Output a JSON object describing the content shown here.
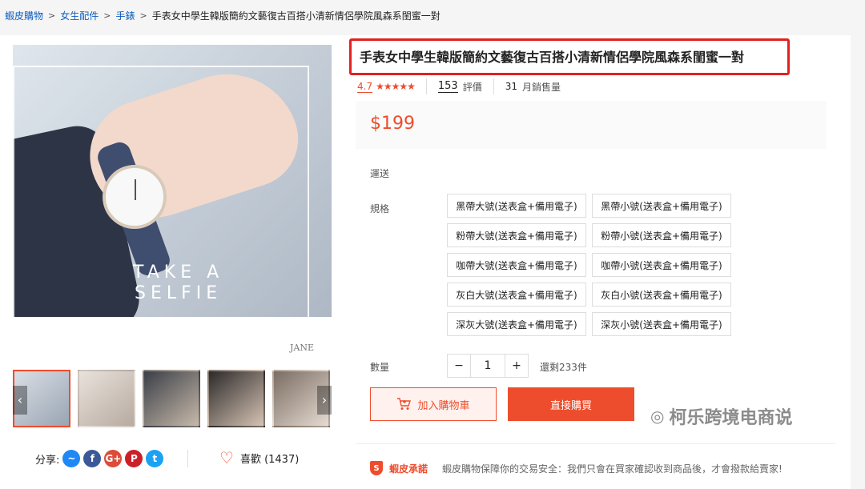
{
  "breadcrumb": [
    "蝦皮購物",
    "女生配件",
    "手錶",
    "手表女中學生韓版簡約文藝復古百搭小清新情侶學院風森系閨蜜一對"
  ],
  "breadcrumb_sep": ">",
  "gallery": {
    "slogan_line1": "TAKE A",
    "slogan_line2": "SELFIE",
    "signature": "JANE",
    "prev": "‹",
    "next": "›"
  },
  "share": {
    "label": "分享:",
    "icons": [
      {
        "name": "messenger-icon",
        "glyph": "~",
        "color": "#1e88f5"
      },
      {
        "name": "facebook-icon",
        "glyph": "f",
        "color": "#3b5998"
      },
      {
        "name": "google-plus-icon",
        "glyph": "G+",
        "color": "#dd4b39"
      },
      {
        "name": "pinterest-icon",
        "glyph": "P",
        "color": "#cb2027"
      },
      {
        "name": "twitter-icon",
        "glyph": "t",
        "color": "#1da1f2"
      }
    ]
  },
  "like": {
    "icon": "heart-icon",
    "label": "喜歡 (1437)"
  },
  "product": {
    "title": "手表女中學生韓版簡約文藝復古百搭小清新情侶學院風森系閨蜜一對",
    "rating": "4.7",
    "stars": "★★★★★",
    "reviews_count": "153",
    "reviews_label": "評價",
    "sold_count": "31",
    "sold_label": "月銷售量",
    "price": "$199"
  },
  "shipping_label": "運送",
  "spec_label": "規格",
  "options": [
    "黑帶大號(送表盒+備用電子)",
    "黑帶小號(送表盒+備用電子)",
    "粉帶大號(送表盒+備用電子)",
    "粉帶小號(送表盒+備用電子)",
    "咖帶大號(送表盒+備用電子)",
    "咖帶小號(送表盒+備用電子)",
    "灰白大號(送表盒+備用電子)",
    "灰白小號(送表盒+備用電子)",
    "深灰大號(送表盒+備用電子)",
    "深灰小號(送表盒+備用電子)"
  ],
  "quantity": {
    "label": "數量",
    "minus": "−",
    "value": "1",
    "plus": "+",
    "stock": "還剩233件"
  },
  "buttons": {
    "add_cart": "加入購物車",
    "buy_now": "直接購買"
  },
  "promise": {
    "badge": "S",
    "title": "蝦皮承諾",
    "text": "蝦皮購物保障你的交易安全：我們只會在買家確認收到商品後，才會撥款給賣家!"
  },
  "watermark": "柯乐跨境电商说",
  "colors": {
    "accent": "#ee4d2d",
    "highlight_box": "#e32020",
    "link": "#0d5ebf"
  }
}
